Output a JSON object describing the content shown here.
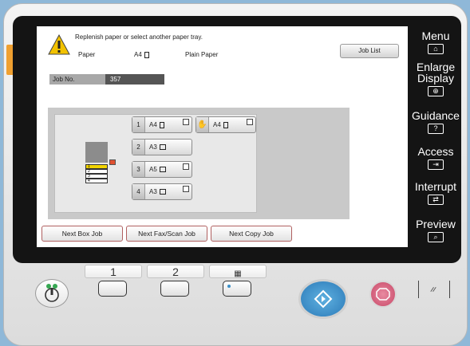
{
  "message": "Replenish paper or select another paper tray.",
  "paper_label": "Paper",
  "paper_size": "A4",
  "paper_type": "Plain Paper",
  "job_list_label": "Job List",
  "job_no_label": "Job No.",
  "job_no_value": "357",
  "trays": [
    {
      "num": "1",
      "size": "A4"
    },
    {
      "num": "",
      "size": "A4"
    },
    {
      "num": "2",
      "size": "A3"
    },
    {
      "num": "3",
      "size": "A5"
    },
    {
      "num": "4",
      "size": "A3"
    }
  ],
  "machine_tray_labels": [
    "1",
    "2",
    "3",
    "4"
  ],
  "bottom_tabs": [
    "Next Box Job",
    "Next Fax/Scan Job",
    "Next Copy Job"
  ],
  "side_buttons": {
    "menu": "Menu",
    "enlarge_1": "Enlarge",
    "enlarge_2": "Display",
    "guidance": "Guidance",
    "guidance_icon": "?",
    "access": "Access",
    "interrupt": "Interrupt",
    "preview": "Preview"
  },
  "keys": {
    "k1": "1",
    "k2": "2"
  },
  "icons": [
    "warning-icon",
    "home-icon",
    "zoom-in-icon",
    "access-icon",
    "interrupt-icon",
    "preview-icon",
    "power-saver-icon",
    "start-icon",
    "stop-icon",
    "keypad-icon"
  ],
  "colors": {
    "accent": "#3a8fc8",
    "stop": "#d8607a",
    "warn": "#f2c200",
    "tab_border": "#b06060"
  }
}
